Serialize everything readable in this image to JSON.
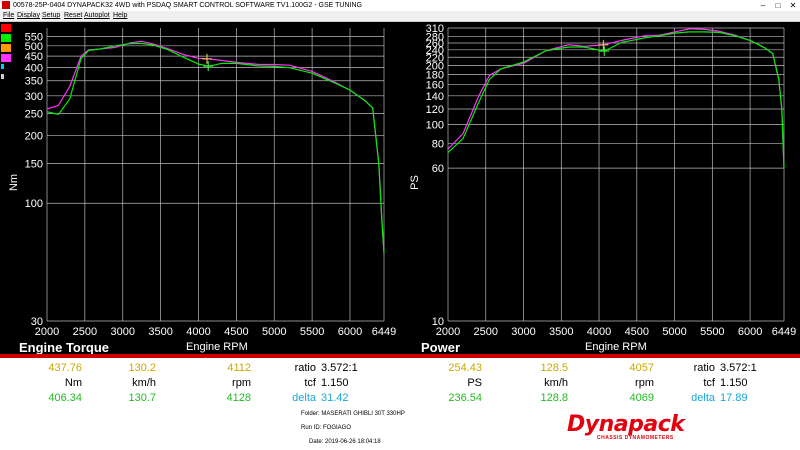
{
  "window": {
    "title": "00578-25P-0404 DYNAPACK32 4WD with PSDAQ SMART CONTROL SOFTWARE TV1.100G2 - GSE TUNING"
  },
  "menu": [
    "File",
    "Display",
    "Setup",
    "Reset",
    "Autoplot",
    "Help"
  ],
  "swatches": [
    "#ff0000",
    "#00ee00",
    "#ff9900",
    "#ff33ff",
    "#00ccff",
    "#cccccc"
  ],
  "colors": {
    "run1": "#ff33ff",
    "run2": "#00ee00",
    "grid": "#bcbcbc",
    "divider": "#d00000"
  },
  "torque": {
    "title": "Engine Torque",
    "xlabel": "Engine RPM",
    "ylabel": "Nm",
    "readout": {
      "run1_value": "437.76",
      "run2_value": "406.34",
      "unit": "Nm"
    }
  },
  "power": {
    "title": "Power",
    "xlabel": "Engine RPM",
    "ylabel": "PS",
    "readout": {
      "run1_value": "254.43",
      "run2_value": "236.54",
      "unit": "PS"
    }
  },
  "readout_left": {
    "speed1": "130.2",
    "speed2": "130.7",
    "speed_unit": "km/h",
    "rpm1": "4112",
    "rpm2": "4128",
    "rpm_unit": "rpm",
    "ratio_label": "ratio",
    "ratio_value": "3.572:1",
    "tcf_label": "tcf",
    "tcf_value": "1.150",
    "delta_label": "delta",
    "delta_value": "31.42"
  },
  "readout_right": {
    "speed1": "128.5",
    "speed2": "128.8",
    "speed_unit": "km/h",
    "rpm1": "4057",
    "rpm2": "4069",
    "rpm_unit": "rpm",
    "ratio_label": "ratio",
    "ratio_value": "3.572:1",
    "tcf_label": "tcf",
    "tcf_value": "1.150",
    "delta_label": "delta",
    "delta_value": "17.89"
  },
  "info": {
    "folder": "Folder:   MASERATI GHIBLI 30T 330HP",
    "runid": "Run ID:   FOGIAGO",
    "date": "Date:   2019-06-26 18:04:18"
  },
  "logo": {
    "text": "Dynapack",
    "sub": "CHASSIS DYNAMOMETERS"
  },
  "chart_data": [
    {
      "type": "line",
      "title": "Engine Torque",
      "xlabel": "Engine RPM",
      "ylabel": "Nm",
      "scale": "log",
      "xlim": [
        2000,
        6449
      ],
      "ylim": [
        30,
        600
      ],
      "xticks": [
        2000,
        2500,
        3000,
        3500,
        4000,
        4500,
        5000,
        5500,
        6000,
        6449
      ],
      "yticks": [
        30,
        100,
        150,
        200,
        250,
        300,
        350,
        400,
        450,
        500,
        550
      ],
      "grid": true,
      "cursor": {
        "rpm": 4112
      },
      "series": [
        {
          "x": [
            2000,
            2150,
            2300,
            2450,
            2550,
            2700,
            2900,
            3100,
            3250,
            3400,
            3600,
            3800,
            4000,
            4112,
            4300,
            4500,
            4800,
            5000,
            5200,
            5500,
            5800,
            6000,
            6200,
            6300,
            6380,
            6420,
            6449
          ],
          "y": [
            262,
            272,
            330,
            450,
            480,
            484,
            492,
            515,
            523,
            510,
            485,
            458,
            440,
            437.76,
            431,
            422,
            413,
            413,
            410,
            385,
            345,
            318,
            285,
            265,
            150,
            85,
            60
          ]
        },
        {
          "x": [
            2000,
            2150,
            2300,
            2450,
            2550,
            2700,
            2900,
            3100,
            3250,
            3400,
            3600,
            3800,
            4000,
            4128,
            4200,
            4300,
            4500,
            4800,
            5000,
            5200,
            5500,
            5800,
            6000,
            6200,
            6300,
            6380,
            6420,
            6449
          ],
          "y": [
            255,
            248,
            290,
            440,
            477,
            484,
            500,
            512,
            512,
            505,
            480,
            445,
            415,
            406.34,
            410,
            418,
            418,
            407,
            405,
            400,
            378,
            342,
            318,
            285,
            265,
            150,
            85,
            60
          ]
        }
      ]
    },
    {
      "type": "line",
      "title": "Power",
      "xlabel": "Engine RPM",
      "ylabel": "PS",
      "scale": "log",
      "xlim": [
        2000,
        6449
      ],
      "ylim": [
        10,
        310
      ],
      "xticks": [
        2000,
        2500,
        3000,
        3500,
        4000,
        4500,
        5000,
        5500,
        6000,
        6449
      ],
      "yticks": [
        10,
        60,
        80,
        100,
        120,
        140,
        160,
        180,
        200,
        220,
        240,
        260,
        280,
        310
      ],
      "grid": true,
      "cursor": {
        "rpm": 4057
      },
      "series": [
        {
          "x": [
            2000,
            2200,
            2400,
            2550,
            2700,
            3000,
            3300,
            3600,
            3800,
            4057,
            4300,
            4600,
            4800,
            5000,
            5200,
            5400,
            5600,
            5800,
            6000,
            6200,
            6300,
            6380,
            6420,
            6449
          ],
          "y": [
            75,
            90,
            138,
            178,
            192,
            205,
            238,
            255,
            250,
            254.43,
            268,
            283,
            285,
            296,
            307,
            305,
            298,
            285,
            268,
            245,
            230,
            170,
            120,
            60
          ]
        },
        {
          "x": [
            2000,
            2200,
            2400,
            2550,
            2700,
            3000,
            3300,
            3600,
            3800,
            4069,
            4300,
            4600,
            4800,
            5000,
            5200,
            5400,
            5600,
            5800,
            6000,
            6200,
            6300,
            6380,
            6420,
            6449
          ],
          "y": [
            72,
            85,
            128,
            170,
            192,
            208,
            238,
            248,
            248,
            236.54,
            262,
            276,
            283,
            292,
            296,
            296,
            294,
            283,
            268,
            245,
            230,
            170,
            120,
            60
          ]
        }
      ]
    }
  ]
}
